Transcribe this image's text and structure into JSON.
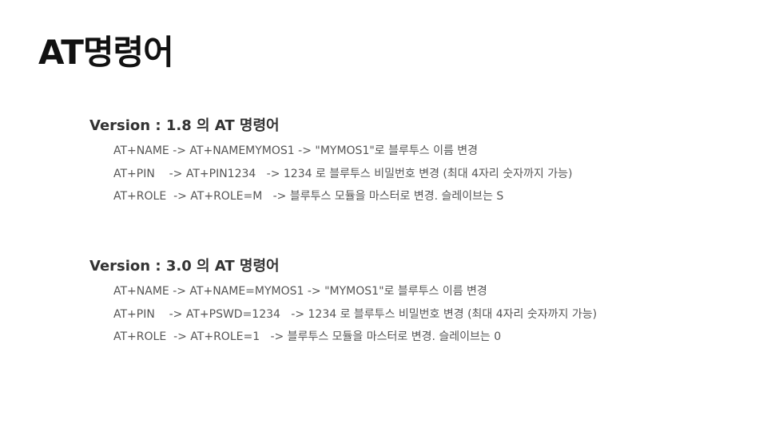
{
  "title": "AT명령어",
  "sections": [
    {
      "heading": "Version : 1.8 의 AT 명령어",
      "lines": [
        "AT+NAME -> AT+NAMEMYMOS1 -> \"MYMOS1\"로 블루투스 이름 변경",
        "AT+PIN    -> AT+PIN1234   -> 1234 로 블루투스 비밀번호 변경 (최대 4자리 숫자까지 가능)",
        "AT+ROLE  -> AT+ROLE=M   -> 블루투스 모듈을 마스터로 변경. 슬레이브는 S"
      ]
    },
    {
      "heading": "Version : 3.0 의 AT 명령어",
      "lines": [
        "AT+NAME -> AT+NAME=MYMOS1 -> \"MYMOS1\"로 블루투스 이름 변경",
        "AT+PIN    -> AT+PSWD=1234   -> 1234 로 블루투스 비밀번호 변경 (최대 4자리 숫자까지 가능)",
        "AT+ROLE  -> AT+ROLE=1   -> 블루투스 모듈을 마스터로 변경. 슬레이브는 0"
      ]
    }
  ]
}
